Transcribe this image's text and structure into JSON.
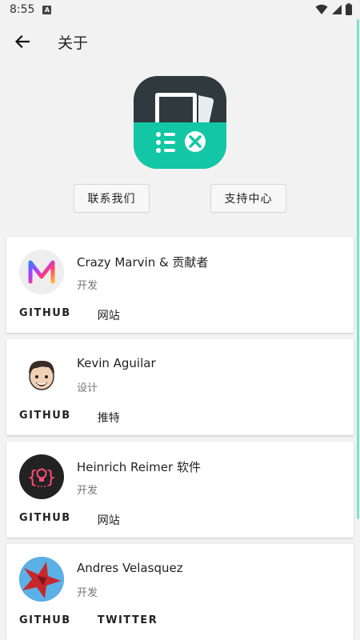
{
  "status": {
    "time": "8:55",
    "badge": "A"
  },
  "header": {
    "title": "关于"
  },
  "buttons": {
    "contact": "联系我们",
    "support": "支持中心"
  },
  "contributors": [
    {
      "name": "Crazy Marvin & 贡献者",
      "role": "开发",
      "actions": [
        "GITHUB",
        "网站"
      ]
    },
    {
      "name": "Kevin Aguilar",
      "role": "设计",
      "actions": [
        "GITHUB",
        "推特"
      ]
    },
    {
      "name": "Heinrich Reimer 软件",
      "role": "开发",
      "actions": [
        "GITHUB",
        "网站"
      ]
    },
    {
      "name": "Andres Velasquez",
      "role": "开发",
      "actions": [
        "GITHUB",
        "TWITTER"
      ]
    }
  ],
  "colors": {
    "accent": "#13c7a6",
    "logo_dark": "#2f3a3f",
    "background": "#f2f2f2"
  },
  "icons": {
    "back": "arrow-left-icon",
    "wifi": "wifi-icon",
    "signal": "signal-icon",
    "battery": "battery-icon"
  }
}
